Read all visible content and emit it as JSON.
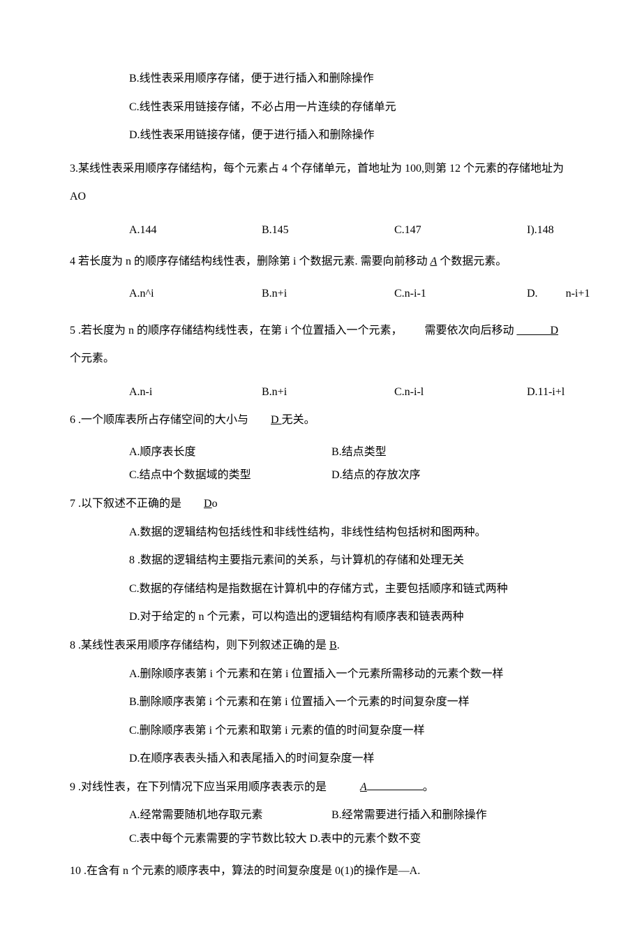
{
  "q2": {
    "optB": "B.线性表采用顺序存储，便于进行插入和删除操作",
    "optC": "C.线性表采用链接存储，不必占用一片连续的存储单元",
    "optD": "D.线性表采用链接存储，便于进行插入和删除操作"
  },
  "q3": {
    "text": "3.某线性表采用顺序存储结构，每个元素占 4 个存储单元，首地址为 100,则第 12 个元素的存储地址为 AO",
    "a": "A.144",
    "b": "B.145",
    "c": "C.147",
    "d": "I).148"
  },
  "q4": {
    "prefix": "4 若长度为 n 的顺序存储结构线性表，删除第 i 个数据元素. 需要向前移动 ",
    "ans": "A",
    "suffix": " 个数据元素。",
    "a": "A.n^i",
    "b": "B.n+i",
    "c": "C.n-i-1",
    "d_label": "D.",
    "d_value": "n-i+1"
  },
  "q5": {
    "prefix": "5   .若长度为 n 的顺序存储结构线性表，在第 i 个位置插入一个元素，  需要依次向后移动 ",
    "ans_pre": "______",
    "ans": "D ",
    "suffix": "个元素。",
    "a": "A.n-i",
    "b": "B.n+i",
    "c": "C.n-i-l",
    "d": "D.11-i+l"
  },
  "q6": {
    "prefix": "6   .一个顺库表所占存储空间的大小与  ",
    "ans": "D ",
    "suffix": "无关。",
    "a": "A.顺序表长度",
    "b": "B.结点类型",
    "c": "C.结点中个数据域的类型",
    "d": "D.结点的存放次序"
  },
  "q7": {
    "prefix": "7   .以下叙述不正确的是  ",
    "ans": "D",
    "suffix": "o",
    "a": "A.数据的逻辑结构包括线性和非线性结构，非线性结构包括树和图两种。",
    "b": "8   .数据的逻辑结构主要指元素间的关系，与计算机的存储和处理无关",
    "c": "C.数据的存储结构是指数据在计算机中的存储方式，主要包括顺序和链式两种",
    "d": "D.对于给定的 n 个元素，可以构造出的逻辑结构有顺序表和链表两种"
  },
  "q8": {
    "prefix": "8   .某线性表采用顺序存储结构，则下列叙述正确的是 ",
    "ans": "B",
    "suffix": ".",
    "a": "A.删除顺序表第 i 个元素和在第 i 位置插入一个元素所需移动的元素个数一样",
    "b": "B.删除顺序表第 i 个元素和在第 i 位置插入一个元素的时间复杂度一样",
    "c": "C.删除顺序表第 i 个元素和取第 i 元素的值的时间复杂度一样",
    "d": "D.在顺序表表头插入和表尾插入的时间复杂度一样"
  },
  "q9": {
    "prefix": "9   .对线性表，在下列情况下应当采用顺序表表示的是   ",
    "ans": "A",
    "suffix": "。",
    "a": "A.经常需要随机地存取元素",
    "b": "B.经常需要进行插入和删除操作",
    "c": "C.表中每个元素需要的字节数比较大 D.表中的元素个数不变"
  },
  "q10": {
    "text": "10   .在含有 n 个元素的顺序表中，算法的时间复杂度是 0(1)的操作是—A."
  }
}
